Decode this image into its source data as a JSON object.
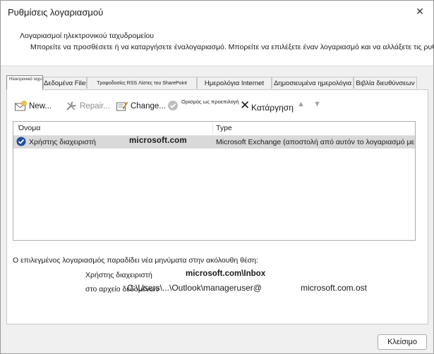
{
  "window": {
    "title": "Ρυθμίσεις λογαριασμού",
    "close_glyph": "✕"
  },
  "header": {
    "heading": "Λογαριασμοί ηλεκτρονικού ταχυδρομείου",
    "description": "Μπορείτε να προσθέσετε ή να καταργήσετε έναλογαριασμό. Μπορείτε να επιλέξετε έναν λογαριασμό και να αλλάξετε τις ρυθμίσεις του."
  },
  "tabs": [
    {
      "label": "Ηλεκτρονικό ταχυδρομείο",
      "active": true
    },
    {
      "label": "Δεδομένα Files",
      "active": false
    },
    {
      "label": "Τροφοδοσίες RSS Λίστες του SharePoint",
      "active": false
    },
    {
      "label": "Ημερολόγια Internet",
      "active": false
    },
    {
      "label": "Δημοσιευμένα ημερολόγια",
      "active": false
    },
    {
      "label": "Βιβλία διευθύνσεων",
      "active": false
    }
  ],
  "toolbar": {
    "new_label": "New...",
    "repair_label": "Repair...",
    "change_label": "Change...",
    "set_default_label": "Ορισμός ως προεπιλογή",
    "remove_glyph": "✕",
    "remove_label": "Κατάργηση",
    "move_up_glyph": "▲",
    "move_down_glyph": "▼"
  },
  "accounts_table": {
    "columns": [
      "Όνομα",
      "Type"
    ],
    "rows": [
      {
        "name": "Χρήστης διαχειριστή",
        "domain": "microsoft.com",
        "type": "Microsoft Exchange (αποστολή από αυτόν το λογαριασμό με def..."
      }
    ]
  },
  "delivery": {
    "description": "Ο επιλεγμένος λογαριασμός παραδίδει νέα μηνύματα στην ακόλουθη θέση:",
    "label_user": "Χρήστης διαχειριστή",
    "inbox_path": "microsoft.com\\Inbox",
    "label_file": "στο αρχείο δεδομένων",
    "file_path": "C:\\Users\\...\\Outlook\\manageruser@",
    "file_domain": "microsoft.com.ost"
  },
  "footer": {
    "close_label": "Κλείσιμο"
  },
  "colors": {
    "selected_row": "#d9d9d9",
    "check_blue": "#1f4e9c"
  }
}
